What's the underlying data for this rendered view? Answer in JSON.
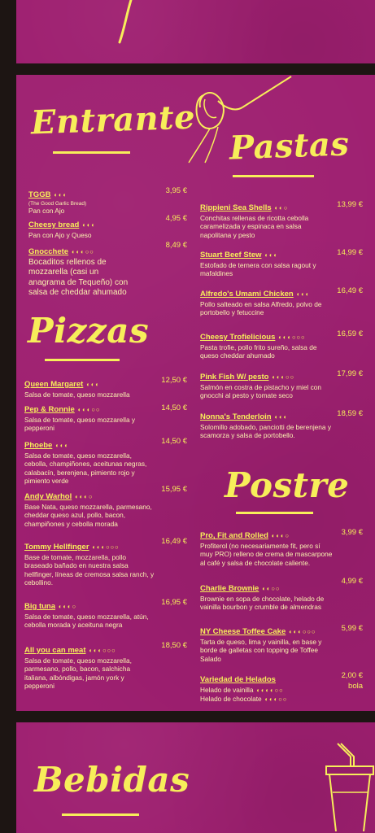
{
  "sections": {
    "entrante": "Entrante",
    "pastas": "Pastas",
    "pizzas": "Pizzas",
    "postre": "Postre",
    "bebidas": "Bebidas"
  },
  "entrantes": [
    {
      "name": "TGGB",
      "sub": "(The Good Garlic Bread)",
      "desc": "Pan con Ajo",
      "price": "3,95 €",
      "icons": "◐◐◐"
    },
    {
      "name": "Cheesy bread",
      "desc": "Pan con Ajo y Queso",
      "price": "4,95 €",
      "icons": "◐◐◐"
    },
    {
      "name": "Gnocchete",
      "desc": "Bocaditos rellenos de mozzarella (casi un anagrama de Tequeño) con salsa de cheddar ahumado",
      "price": "8,49 €",
      "icons": "◐◐◐○○"
    }
  ],
  "pizzas": [
    {
      "name": "Queen Margaret",
      "desc": "Salsa de tomate, queso mozzarella",
      "price": "12,50 €",
      "icons": "◐◐◐"
    },
    {
      "name": "Pep & Ronnie",
      "desc": "Salsa de tomate, queso mozzarella y pepperoni",
      "price": "14,50 €",
      "icons": "◐◐◐○○"
    },
    {
      "name": "Phoebe",
      "desc": "Salsa de tomate, queso mozzarella, cebolla, champiñones, aceitunas negras, calabacín, berenjena, pimiento rojo y pimiento verde",
      "price": "14,50 €",
      "icons": "◐◐◐"
    },
    {
      "name": "Andy Warhol",
      "desc": "Base Nata, queso mozzarella, parmesano, cheddar queso azul, pollo, bacon, champiñones y cebolla morada",
      "price": "15,95 €",
      "icons": "◐◐◐○"
    },
    {
      "name": "Tommy Hellfinger",
      "desc": "Base de tomate, mozzarella, pollo braseado bañado en nuestra salsa hellfinger, líneas de cremosa salsa ranch, y cebollino.",
      "price": "16,49 €",
      "icons": "◐◐◐○○○"
    },
    {
      "name": "Big tuna",
      "desc": "Salsa de tomate, queso mozzarella, atún, cebolla morada y aceituna negra",
      "price": "16,95 €",
      "icons": "◐◐◐○"
    },
    {
      "name": "All you can meat",
      "desc": "Salsa de tomate, queso mozzarella, parmesano, pollo, bacon, salchicha italiana, albóndigas, jamón york y pepperoni",
      "price": "18,50 €",
      "icons": "◐◐◐○○○"
    }
  ],
  "pastas": [
    {
      "name": "Rippieni Sea Shells",
      "desc": "Conchitas rellenas de ricotta cebolla caramelizada y espinaca en salsa napolitana y pesto",
      "price": "13,99 €",
      "icons": "◐◐○"
    },
    {
      "name": "Stuart Beef Stew",
      "desc": "Estofado de ternera con salsa ragout y mafaldines",
      "price": "14,99 €",
      "icons": "◐◐◐"
    },
    {
      "name": "Alfredo's Umami Chicken",
      "desc": "Pollo salteado en salsa Alfredo, polvo de portobello y fetuccine",
      "price": "16,49 €",
      "icons": "◐◐◐"
    },
    {
      "name": "Cheesy Trofielicious",
      "desc": "Pasta trofie, pollo frito sureño, salsa de queso cheddar ahumado",
      "price": "16,59 €",
      "icons": "◐◐◐○○○"
    },
    {
      "name": "Pink Fish W/ pesto",
      "desc": "Salmón en costra de pistacho y miel con gnocchi al pesto y tomate seco",
      "price": "17,99 €",
      "icons": "◐◐◐○○"
    },
    {
      "name": "Nonna's Tenderloin",
      "desc": "Solomillo adobado, panciotti de berenjena y scamorza y salsa de portobello.",
      "price": "18,59 €",
      "icons": "◐◐◐"
    }
  ],
  "postres": [
    {
      "name": "Pro, Fit and Rolled",
      "desc": "Profiterol (no necesariamente fit, pero sí muy PRO) relleno de crema de mascarpone al café y salsa de chocolate caliente.",
      "price": "3,99 €",
      "icons": "◐◐◐○"
    },
    {
      "name": "Charlie Brownie",
      "desc": "Brownie en sopa de chocolate, helado de vainilla bourbon y crumble de almendras",
      "price": "4,99 €",
      "icons": "◐◐○○"
    },
    {
      "name": "NY Cheese Toffee Cake",
      "desc": "Tarta de queso, lima y vainilla, en base y borde de galletas con topping de Toffee Salado",
      "price": "5,99 €",
      "icons": "◐◐◐○○○"
    },
    {
      "name": "Variedad de Helados",
      "desc": "Helado de vainilla",
      "desc2": "Helado de chocolate",
      "price": "2,00 €",
      "price2": "bola",
      "icons2": "◐◐◐◐○○",
      "icons3": "◐◐◐○○"
    }
  ]
}
